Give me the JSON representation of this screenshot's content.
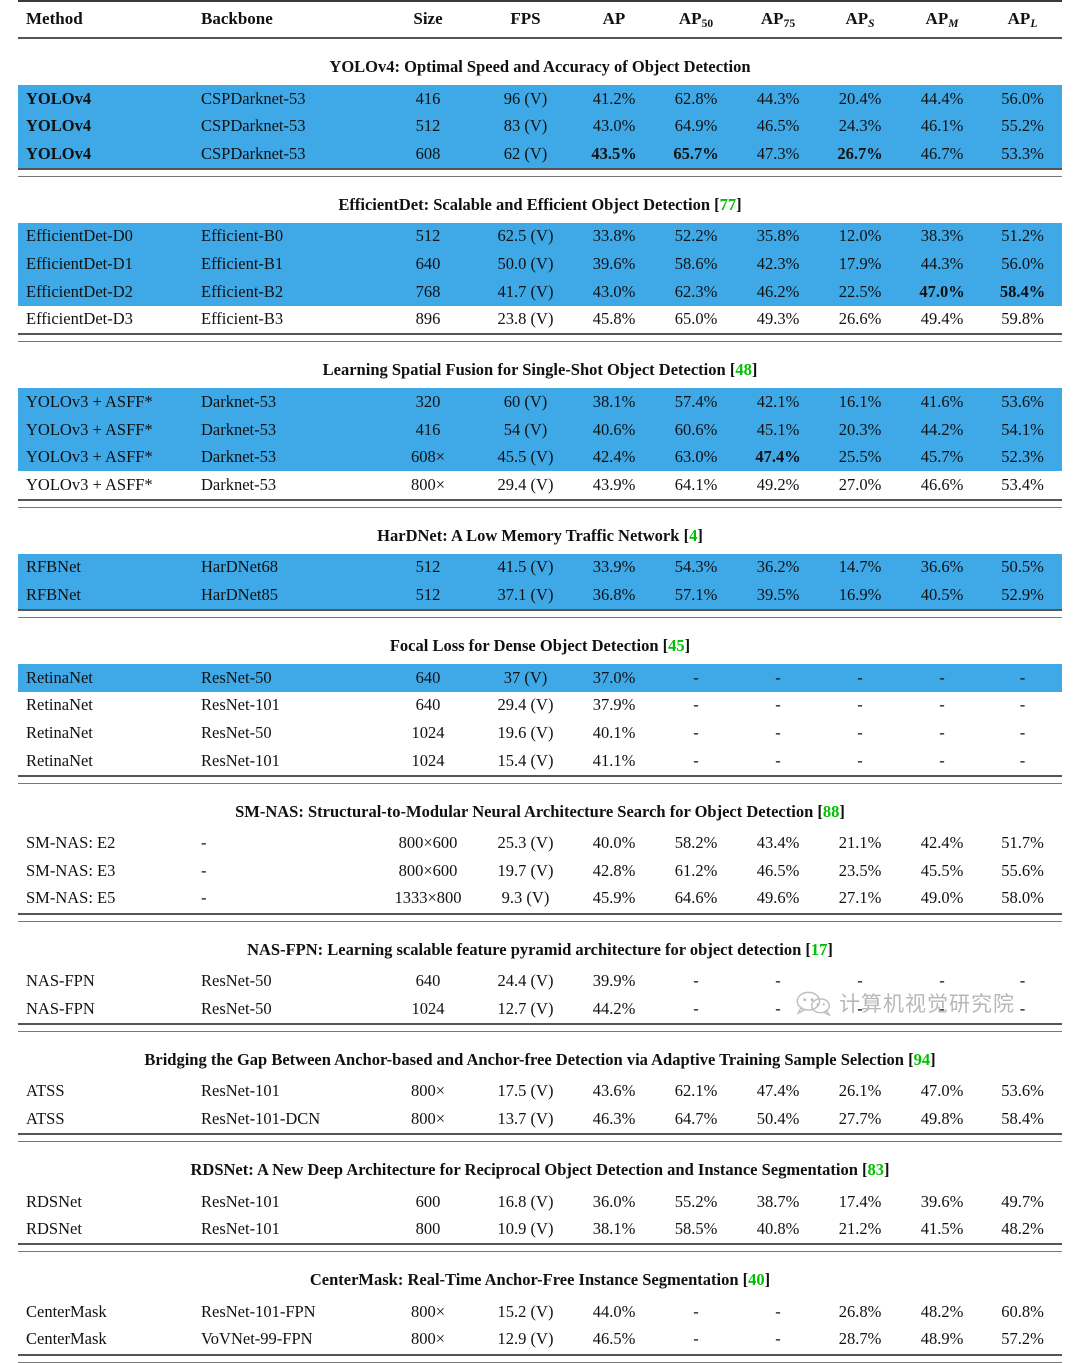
{
  "table": {
    "columns": [
      {
        "key": "method",
        "label": "Method",
        "align": "left"
      },
      {
        "key": "backbone",
        "label": "Backbone",
        "align": "left"
      },
      {
        "key": "size",
        "label": "Size",
        "align": "center"
      },
      {
        "key": "fps",
        "label": "FPS",
        "align": "center"
      },
      {
        "key": "ap",
        "label": "AP",
        "sub": "",
        "align": "center"
      },
      {
        "key": "ap50",
        "label": "AP",
        "sub": "50",
        "align": "center"
      },
      {
        "key": "ap75",
        "label": "AP",
        "sub": "75",
        "align": "center"
      },
      {
        "key": "aps",
        "label": "AP",
        "sub": "S",
        "align": "center"
      },
      {
        "key": "apm",
        "label": "AP",
        "sub": "M",
        "align": "center"
      },
      {
        "key": "apl",
        "label": "AP",
        "sub": "L",
        "align": "center"
      }
    ],
    "colors": {
      "highlight_blue": "#3fa9e8",
      "citation_green": "#00c000",
      "rule_dark": "#3a3a3a",
      "text": "#111111"
    },
    "sections": [
      {
        "title": "YOLOv4: Optimal Speed and Accuracy of Object Detection",
        "citation": "",
        "rows": [
          {
            "highlight": true,
            "bold_method": true,
            "cells": [
              "YOLOv4",
              "CSPDarknet-53",
              "416",
              "96 (V)",
              "41.2%",
              "62.8%",
              "44.3%",
              "20.4%",
              "44.4%",
              "56.0%"
            ],
            "bold": []
          },
          {
            "highlight": true,
            "bold_method": true,
            "cells": [
              "YOLOv4",
              "CSPDarknet-53",
              "512",
              "83 (V)",
              "43.0%",
              "64.9%",
              "46.5%",
              "24.3%",
              "46.1%",
              "55.2%"
            ],
            "bold": []
          },
          {
            "highlight": true,
            "bold_method": true,
            "cells": [
              "YOLOv4",
              "CSPDarknet-53",
              "608",
              "62 (V)",
              "43.5%",
              "65.7%",
              "47.3%",
              "26.7%",
              "46.7%",
              "53.3%"
            ],
            "bold": [
              4,
              5,
              7
            ]
          }
        ]
      },
      {
        "title": "EfficientDet: Scalable and Efficient Object Detection",
        "citation": "77",
        "rows": [
          {
            "highlight": true,
            "bold_method": false,
            "cells": [
              "EfficientDet-D0",
              "Efficient-B0",
              "512",
              "62.5 (V)",
              "33.8%",
              "52.2%",
              "35.8%",
              "12.0%",
              "38.3%",
              "51.2%"
            ],
            "bold": []
          },
          {
            "highlight": true,
            "bold_method": false,
            "cells": [
              "EfficientDet-D1",
              "Efficient-B1",
              "640",
              "50.0 (V)",
              "39.6%",
              "58.6%",
              "42.3%",
              "17.9%",
              "44.3%",
              "56.0%"
            ],
            "bold": []
          },
          {
            "highlight": true,
            "bold_method": false,
            "cells": [
              "EfficientDet-D2",
              "Efficient-B2",
              "768",
              "41.7 (V)",
              "43.0%",
              "62.3%",
              "46.2%",
              "22.5%",
              "47.0%",
              "58.4%"
            ],
            "bold": [
              8,
              9
            ]
          },
          {
            "highlight": false,
            "bold_method": false,
            "cells": [
              "EfficientDet-D3",
              "Efficient-B3",
              "896",
              "23.8 (V)",
              "45.8%",
              "65.0%",
              "49.3%",
              "26.6%",
              "49.4%",
              "59.8%"
            ],
            "bold": []
          }
        ]
      },
      {
        "title": "Learning Spatial Fusion for Single-Shot Object Detection",
        "citation": "48",
        "rows": [
          {
            "highlight": true,
            "bold_method": false,
            "cells": [
              "YOLOv3 + ASFF*",
              "Darknet-53",
              "320",
              "60 (V)",
              "38.1%",
              "57.4%",
              "42.1%",
              "16.1%",
              "41.6%",
              "53.6%"
            ],
            "bold": []
          },
          {
            "highlight": true,
            "bold_method": false,
            "cells": [
              "YOLOv3 + ASFF*",
              "Darknet-53",
              "416",
              "54 (V)",
              "40.6%",
              "60.6%",
              "45.1%",
              "20.3%",
              "44.2%",
              "54.1%"
            ],
            "bold": []
          },
          {
            "highlight": true,
            "bold_method": false,
            "cells": [
              "YOLOv3 + ASFF*",
              "Darknet-53",
              "608×",
              "45.5 (V)",
              "42.4%",
              "63.0%",
              "47.4%",
              "25.5%",
              "45.7%",
              "52.3%"
            ],
            "bold": [
              6
            ]
          },
          {
            "highlight": false,
            "bold_method": false,
            "cells": [
              "YOLOv3 + ASFF*",
              "Darknet-53",
              "800×",
              "29.4 (V)",
              "43.9%",
              "64.1%",
              "49.2%",
              "27.0%",
              "46.6%",
              "53.4%"
            ],
            "bold": []
          }
        ]
      },
      {
        "title": "HarDNet: A Low Memory Traffic Network",
        "citation": "4",
        "rows": [
          {
            "highlight": true,
            "bold_method": false,
            "cells": [
              "RFBNet",
              "HarDNet68",
              "512",
              "41.5 (V)",
              "33.9%",
              "54.3%",
              "36.2%",
              "14.7%",
              "36.6%",
              "50.5%"
            ],
            "bold": []
          },
          {
            "highlight": true,
            "bold_method": false,
            "cells": [
              "RFBNet",
              "HarDNet85",
              "512",
              "37.1 (V)",
              "36.8%",
              "57.1%",
              "39.5%",
              "16.9%",
              "40.5%",
              "52.9%"
            ],
            "bold": []
          }
        ]
      },
      {
        "title": "Focal Loss for Dense Object Detection",
        "citation": "45",
        "rows": [
          {
            "highlight": true,
            "bold_method": false,
            "cells": [
              "RetinaNet",
              "ResNet-50",
              "640",
              "37 (V)",
              "37.0%",
              "-",
              "-",
              "-",
              "-",
              "-"
            ],
            "bold": []
          },
          {
            "highlight": false,
            "bold_method": false,
            "cells": [
              "RetinaNet",
              "ResNet-101",
              "640",
              "29.4 (V)",
              "37.9%",
              "-",
              "-",
              "-",
              "-",
              "-"
            ],
            "bold": []
          },
          {
            "highlight": false,
            "bold_method": false,
            "cells": [
              "RetinaNet",
              "ResNet-50",
              "1024",
              "19.6 (V)",
              "40.1%",
              "-",
              "-",
              "-",
              "-",
              "-"
            ],
            "bold": []
          },
          {
            "highlight": false,
            "bold_method": false,
            "cells": [
              "RetinaNet",
              "ResNet-101",
              "1024",
              "15.4 (V)",
              "41.1%",
              "-",
              "-",
              "-",
              "-",
              "-"
            ],
            "bold": []
          }
        ]
      },
      {
        "title": "SM-NAS: Structural-to-Modular Neural Architecture Search for Object Detection",
        "citation": "88",
        "rows": [
          {
            "highlight": false,
            "bold_method": false,
            "cells": [
              "SM-NAS: E2",
              "-",
              "800×600",
              "25.3 (V)",
              "40.0%",
              "58.2%",
              "43.4%",
              "21.1%",
              "42.4%",
              "51.7%"
            ],
            "bold": []
          },
          {
            "highlight": false,
            "bold_method": false,
            "cells": [
              "SM-NAS: E3",
              "-",
              "800×600",
              "19.7 (V)",
              "42.8%",
              "61.2%",
              "46.5%",
              "23.5%",
              "45.5%",
              "55.6%"
            ],
            "bold": []
          },
          {
            "highlight": false,
            "bold_method": false,
            "cells": [
              "SM-NAS: E5",
              "-",
              "1333×800",
              "9.3 (V)",
              "45.9%",
              "64.6%",
              "49.6%",
              "27.1%",
              "49.0%",
              "58.0%"
            ],
            "bold": []
          }
        ]
      },
      {
        "title": "NAS-FPN: Learning scalable feature pyramid architecture for object detection",
        "citation": "17",
        "rows": [
          {
            "highlight": false,
            "bold_method": false,
            "cells": [
              "NAS-FPN",
              "ResNet-50",
              "640",
              "24.4 (V)",
              "39.9%",
              "-",
              "-",
              "-",
              "-",
              "-"
            ],
            "bold": []
          },
          {
            "highlight": false,
            "bold_method": false,
            "cells": [
              "NAS-FPN",
              "ResNet-50",
              "1024",
              "12.7 (V)",
              "44.2%",
              "-",
              "-",
              "-",
              "-",
              "-"
            ],
            "bold": []
          }
        ]
      },
      {
        "title": "Bridging the Gap Between Anchor-based and Anchor-free Detection via Adaptive Training Sample Selection",
        "citation": "94",
        "rows": [
          {
            "highlight": false,
            "bold_method": false,
            "cells": [
              "ATSS",
              "ResNet-101",
              "800×",
              "17.5 (V)",
              "43.6%",
              "62.1%",
              "47.4%",
              "26.1%",
              "47.0%",
              "53.6%"
            ],
            "bold": []
          },
          {
            "highlight": false,
            "bold_method": false,
            "cells": [
              "ATSS",
              "ResNet-101-DCN",
              "800×",
              "13.7 (V)",
              "46.3%",
              "64.7%",
              "50.4%",
              "27.7%",
              "49.8%",
              "58.4%"
            ],
            "bold": []
          }
        ]
      },
      {
        "title": "RDSNet: A New Deep Architecture for Reciprocal Object Detection and Instance Segmentation",
        "citation": "83",
        "rows": [
          {
            "highlight": false,
            "bold_method": false,
            "cells": [
              "RDSNet",
              "ResNet-101",
              "600",
              "16.8 (V)",
              "36.0%",
              "55.2%",
              "38.7%",
              "17.4%",
              "39.6%",
              "49.7%"
            ],
            "bold": []
          },
          {
            "highlight": false,
            "bold_method": false,
            "cells": [
              "RDSNet",
              "ResNet-101",
              "800",
              "10.9 (V)",
              "38.1%",
              "58.5%",
              "40.8%",
              "21.2%",
              "41.5%",
              "48.2%"
            ],
            "bold": []
          }
        ]
      },
      {
        "title": "CenterMask: Real-Time Anchor-Free Instance Segmentation",
        "citation": "40",
        "rows": [
          {
            "highlight": false,
            "bold_method": false,
            "cells": [
              "CenterMask",
              "ResNet-101-FPN",
              "800×",
              "15.2 (V)",
              "44.0%",
              "-",
              "-",
              "26.8%",
              "48.2%",
              "60.8%"
            ],
            "bold": []
          },
          {
            "highlight": false,
            "bold_method": false,
            "cells": [
              "CenterMask",
              "VoVNet-99-FPN",
              "800×",
              "12.9 (V)",
              "46.5%",
              "-",
              "-",
              "28.7%",
              "48.9%",
              "57.2%"
            ],
            "bold": []
          }
        ]
      }
    ]
  },
  "watermark": {
    "text": "计算机视觉研究院",
    "icon": "wechat-icon"
  }
}
